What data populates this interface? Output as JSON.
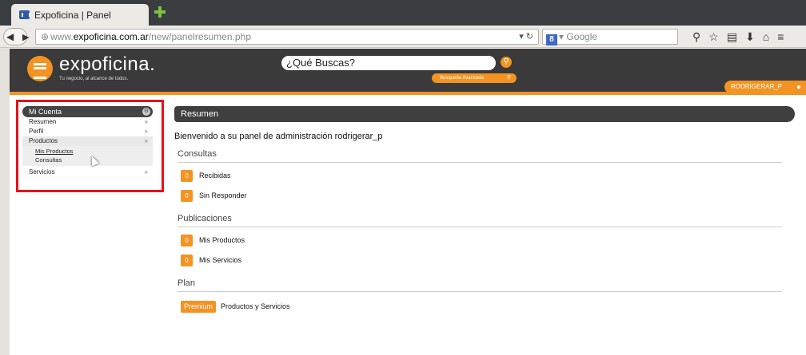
{
  "browser": {
    "tab_title": "Expoficina | Panel",
    "url_prefix": "www.",
    "url_host": "expoficina.com.ar",
    "url_path": "/new/panelresumen.php",
    "search_engine": "Google",
    "search_placeholder": "Google"
  },
  "header": {
    "logo_text": "expoficina.",
    "tagline": "Tu negocio, al alcance de todos.",
    "search_placeholder": "¿Qué Buscas?",
    "advanced_search_label": "Busqueda Avanzada",
    "username": "RODRIGERAR_P",
    "accent_color": "#f39322"
  },
  "sidebar": {
    "title": "Mi Cuenta",
    "items": [
      {
        "label": "Resumen",
        "chevron": "»"
      },
      {
        "label": "Perfil",
        "chevron": "»"
      },
      {
        "label": "Productos",
        "chevron": "»"
      },
      {
        "label": "Servicios",
        "chevron": "»"
      }
    ],
    "sub_items": [
      {
        "label": "Mis Productos"
      },
      {
        "label": "Consultas"
      }
    ]
  },
  "main": {
    "title": "Resumen",
    "welcome": "Bienvenido a su panel de administración rodrigerar_p",
    "consultas": {
      "title": "Consultas",
      "rows": [
        {
          "count": "0",
          "label": "Recibidas"
        },
        {
          "count": "0",
          "label": "Sin Responder"
        }
      ]
    },
    "publicaciones": {
      "title": "Publicaciones",
      "rows": [
        {
          "count": "0",
          "label": "Mis Productos"
        },
        {
          "count": "0",
          "label": "Mis Servicios"
        }
      ]
    },
    "plan": {
      "title": "Plan",
      "badge": "Premium",
      "label": "Productos y Servicios"
    }
  }
}
